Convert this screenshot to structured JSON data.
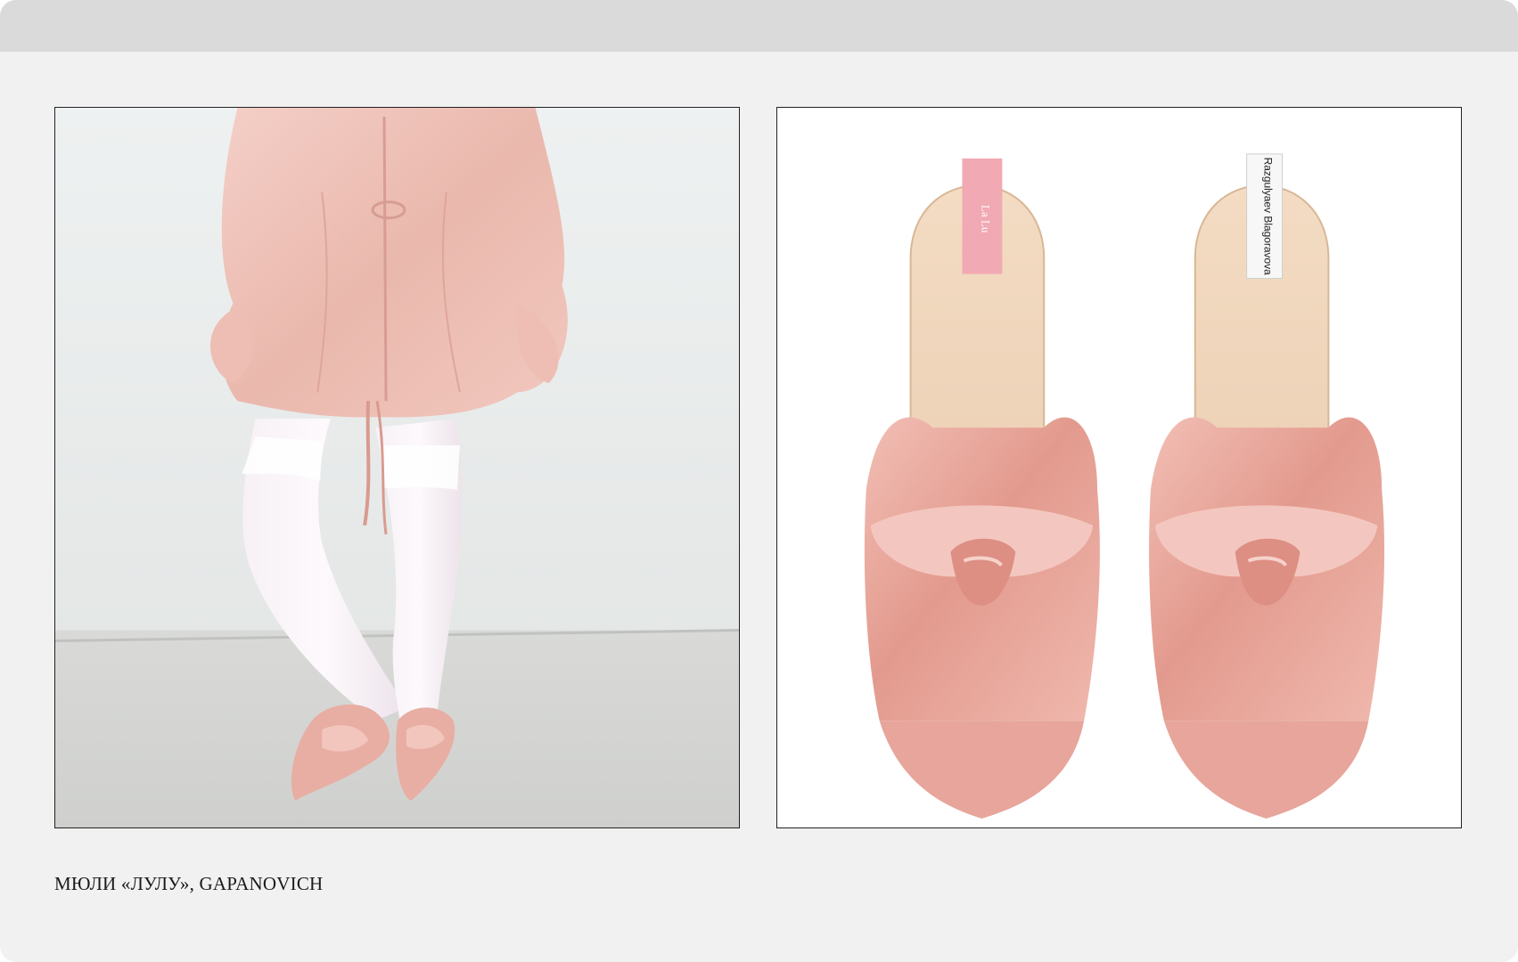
{
  "caption": "МЮЛИ «ЛУЛУ», GAPANOVICH",
  "images": {
    "left": {
      "name": "model-wearing-pink-satin-mules"
    },
    "right": {
      "name": "pink-satin-mules-product-shot",
      "insole_label_left": "La Lu",
      "insole_label_right": "Razgulyaev Blagoravova"
    }
  },
  "colors": {
    "window_bg": "#f1f1f1",
    "titlebar": "#dadada",
    "satin_pink": "#e7a79e",
    "insole": "#f0d7bd",
    "caption_text": "#1a1a1a"
  }
}
